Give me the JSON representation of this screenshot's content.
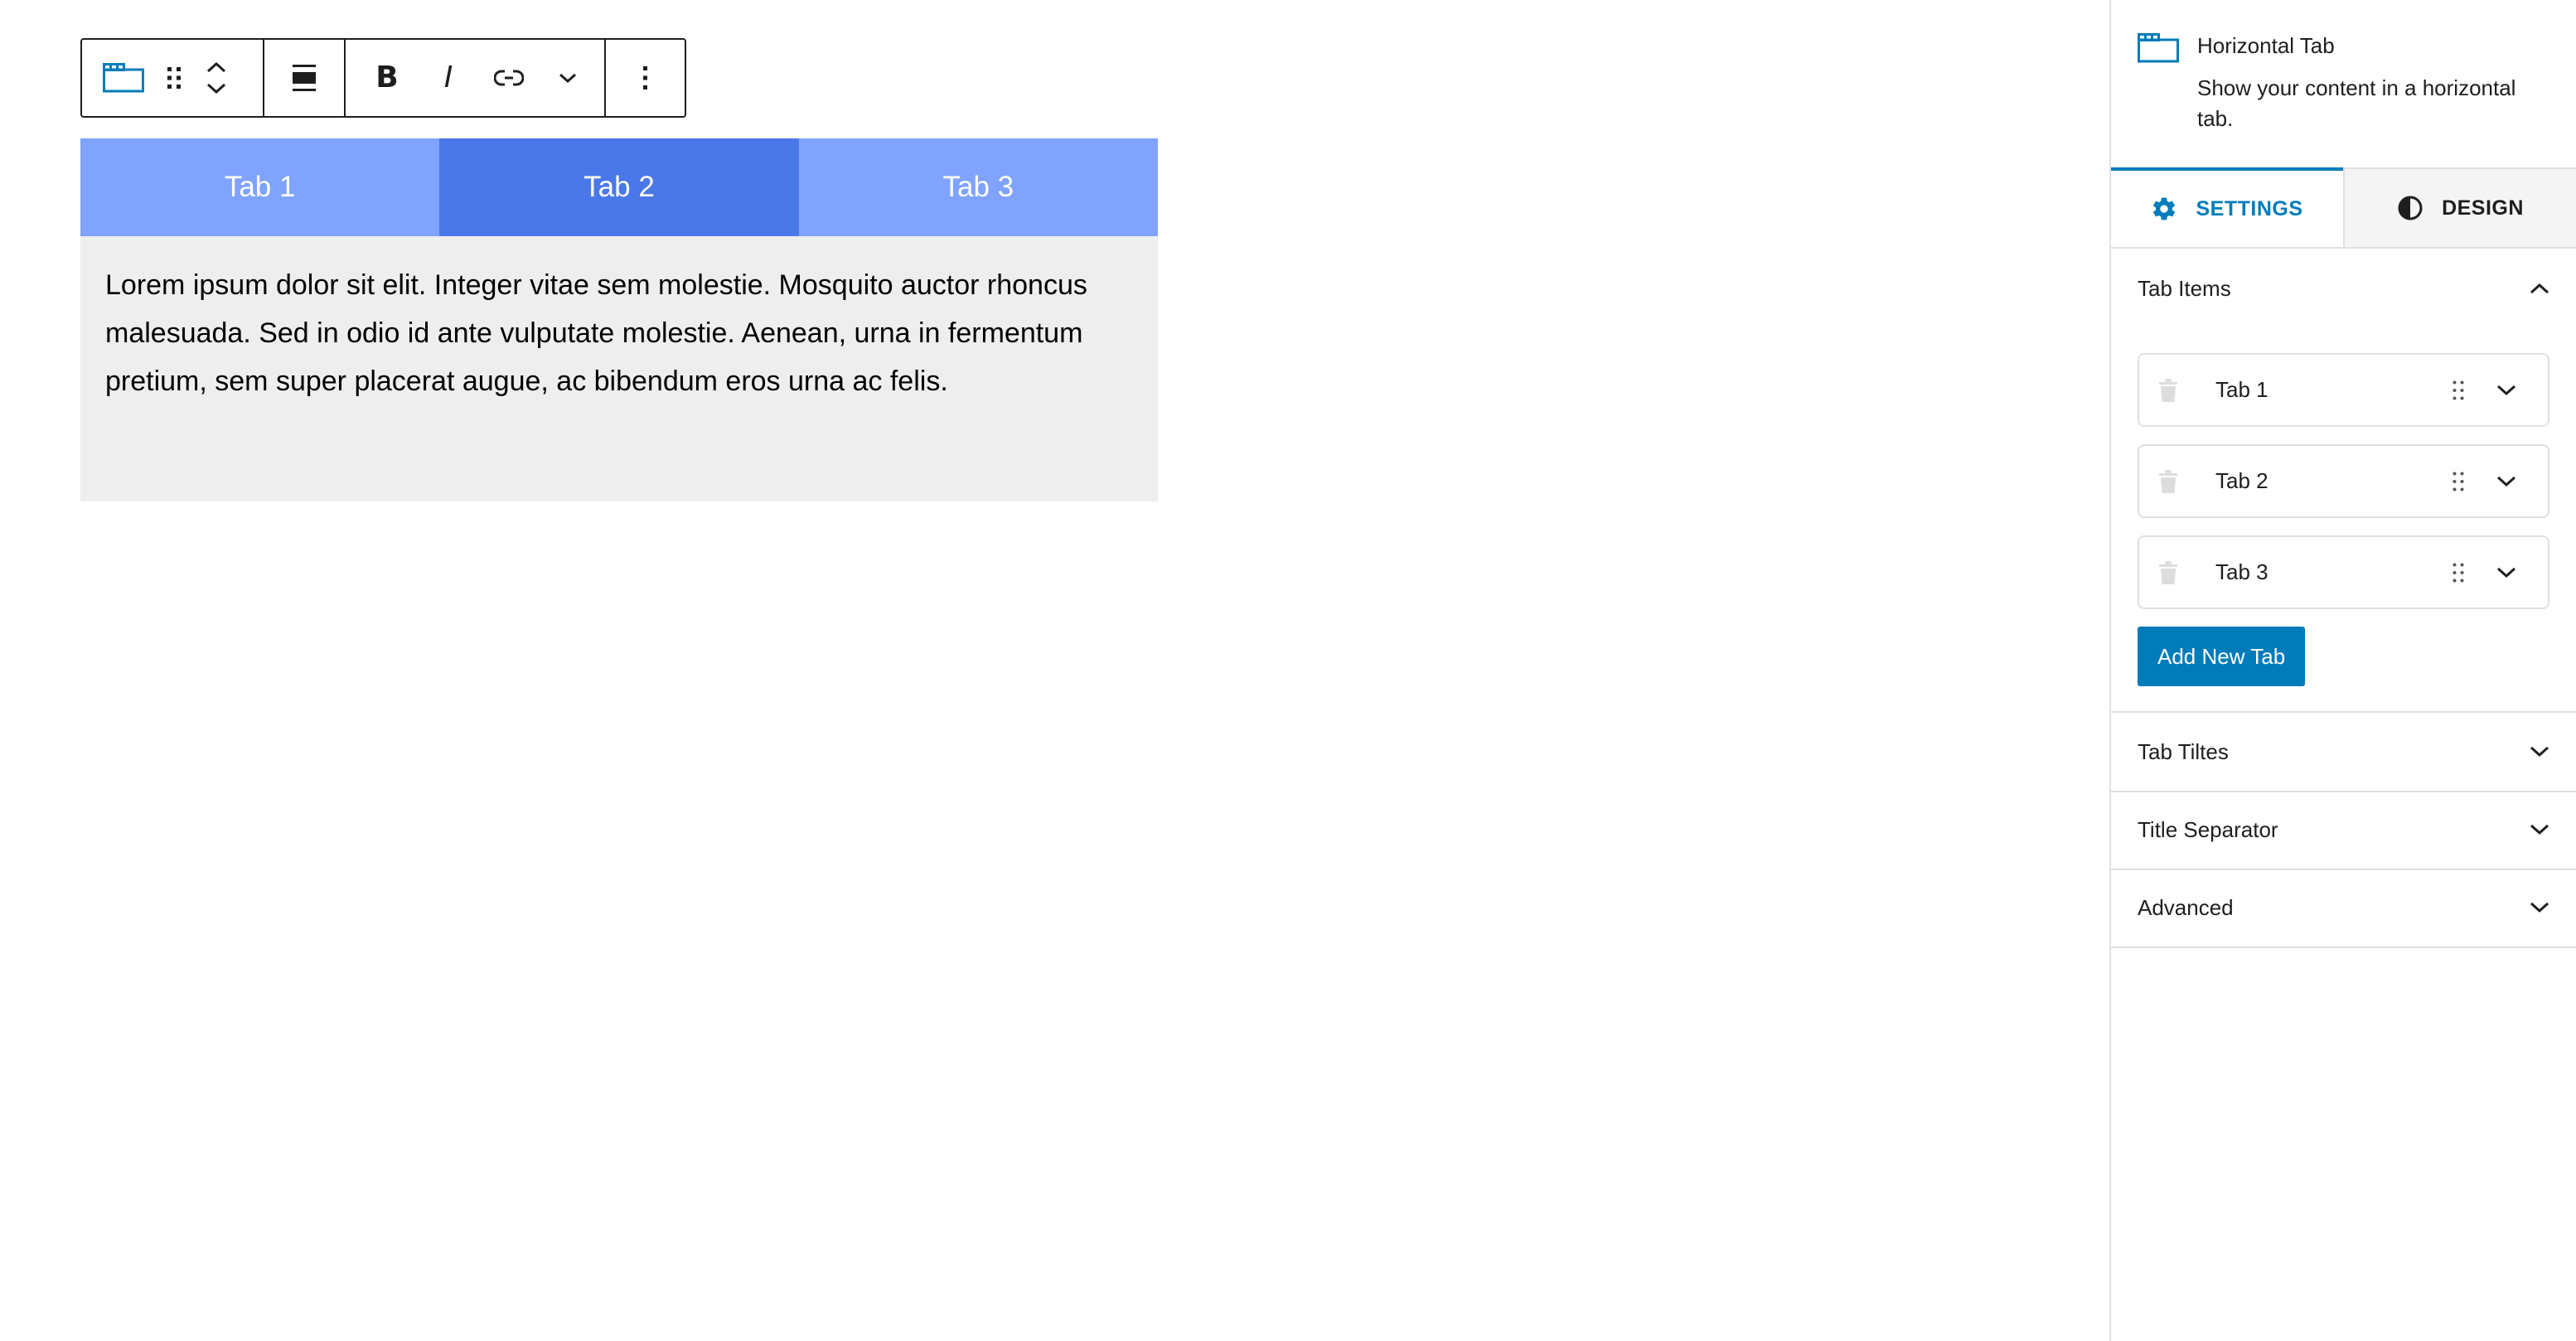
{
  "toolbar": {
    "buttons": [
      {
        "name": "block-type",
        "icon": "horizontal-tab-icon"
      },
      {
        "name": "drag",
        "icon": "drag-handle-icon"
      },
      {
        "name": "move-up",
        "icon": "chevron-up-icon"
      },
      {
        "name": "move-down",
        "icon": "chevron-down-icon"
      },
      {
        "name": "align",
        "icon": "align-wide-icon"
      },
      {
        "name": "bold",
        "icon": "bold-icon",
        "label": "B"
      },
      {
        "name": "italic",
        "icon": "italic-icon",
        "label": "I"
      },
      {
        "name": "link",
        "icon": "link-icon"
      },
      {
        "name": "more-formatting",
        "icon": "chevron-down-icon"
      },
      {
        "name": "options",
        "icon": "more-vertical-icon"
      }
    ],
    "bold_label": "B",
    "italic_label": "I"
  },
  "tabs_block": {
    "tabs": [
      {
        "label": "Tab 1",
        "active": false
      },
      {
        "label": "Tab 2",
        "active": true
      },
      {
        "label": "Tab 3",
        "active": false
      }
    ],
    "content": "Lorem ipsum dolor sit elit. Integer vitae sem molestie. Mosquito auctor rhoncus malesuada. Sed in odio id ante vulputate molestie. Aenean, urna in fermentum pretium, sem super placerat augue, ac bibendum eros urna ac felis.",
    "colors": {
      "tab_inactive": "#7fa3ff",
      "tab_active": "#4b78e8",
      "tab_text": "#ffffff",
      "content_bg": "#eeeeee"
    }
  },
  "sidebar": {
    "block": {
      "icon": "horizontal-tab-icon",
      "title": "Horizontal Tab",
      "description": "Show your content in a horizontal tab."
    },
    "tabs": [
      {
        "label": "SETTINGS",
        "icon": "gear-icon",
        "active": true
      },
      {
        "label": "DESIGN",
        "icon": "contrast-icon",
        "active": false
      }
    ],
    "tab_items_panel": {
      "title": "Tab Items",
      "expanded": true,
      "items": [
        {
          "label": "Tab 1"
        },
        {
          "label": "Tab 2"
        },
        {
          "label": "Tab 3"
        }
      ],
      "add_button": "Add New Tab"
    },
    "panels": [
      {
        "title": "Tab Tiltes",
        "expanded": false
      },
      {
        "title": "Title Separator",
        "expanded": false
      },
      {
        "title": "Advanced",
        "expanded": false
      }
    ],
    "colors": {
      "accent": "#007cba",
      "border": "#e0e0e0"
    }
  }
}
